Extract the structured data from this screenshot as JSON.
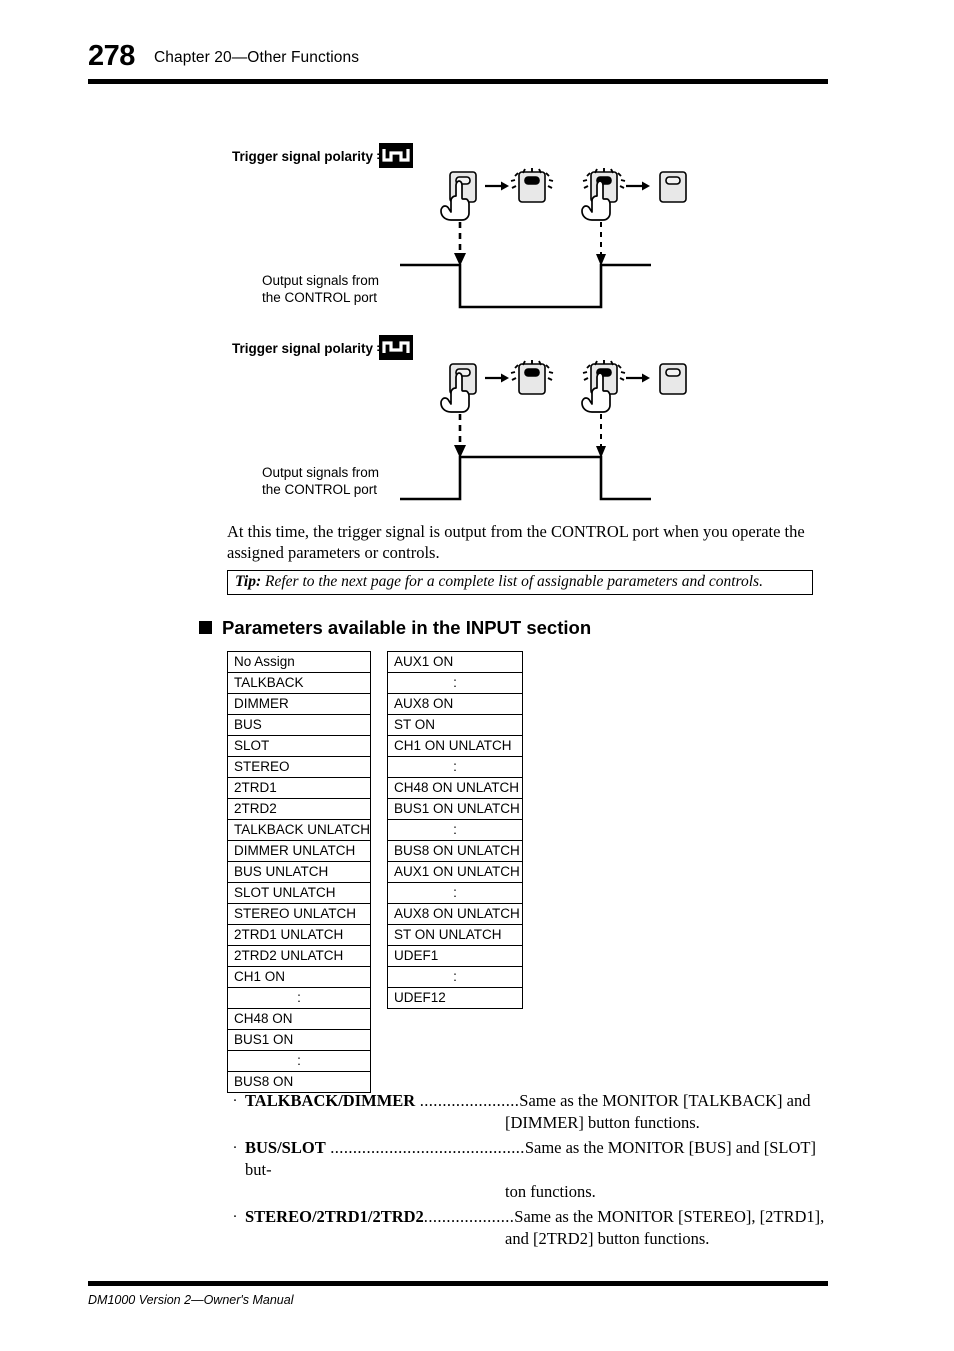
{
  "header": {
    "page_number": "278",
    "chapter_title": "Chapter 20—Other Functions"
  },
  "figures": [
    {
      "polarity_label": "Trigger signal polarity =",
      "polarity_icon": "falling-pulse-icon",
      "output_label_line1": "Output signals from",
      "output_label_line2": "the CONTROL port",
      "waveform": "low-pulse"
    },
    {
      "polarity_label": "Trigger signal polarity =",
      "polarity_icon": "rising-pulse-icon",
      "output_label_line1": "Output signals from",
      "output_label_line2": "the CONTROL port",
      "waveform": "high-pulse"
    }
  ],
  "body_paragraph": "At this time, the trigger signal is output from the CONTROL port when you operate the assigned parameters or controls.",
  "tip": {
    "label": "Tip:",
    "text": "Refer to the next page for a complete list of assignable parameters and controls."
  },
  "section_heading": "Parameters available in the INPUT section",
  "table_left": [
    "No Assign",
    "TALKBACK",
    "DIMMER",
    "BUS",
    "SLOT",
    "STEREO",
    "2TRD1",
    "2TRD2",
    "TALKBACK UNLATCH",
    "DIMMER UNLATCH",
    "BUS UNLATCH",
    "SLOT UNLATCH",
    "STEREO UNLATCH",
    "2TRD1 UNLATCH",
    "2TRD2 UNLATCH",
    "CH1 ON",
    ":",
    "CH48 ON",
    "BUS1 ON",
    ":",
    "BUS8 ON"
  ],
  "table_right": [
    "AUX1 ON",
    ":",
    "AUX8 ON",
    "ST ON",
    "CH1 ON UNLATCH",
    ":",
    "CH48 ON UNLATCH",
    "BUS1 ON UNLATCH",
    ":",
    "BUS8 ON UNLATCH",
    "AUX1 ON UNLATCH",
    ":",
    "AUX8 ON UNLATCH",
    "ST ON UNLATCH",
    "UDEF1",
    ":",
    "UDEF12"
  ],
  "bullets": [
    {
      "marker": "·",
      "term": "TALKBACK/DIMMER",
      "leader": " ......................",
      "desc_line1": "Same as the MONITOR [TALKBACK] and",
      "desc_line2": "[DIMMER] button functions."
    },
    {
      "marker": "·",
      "term": "BUS/SLOT",
      "leader": " ...........................................",
      "desc_line1": "Same as the MONITOR [BUS] and [SLOT] but-",
      "desc_line2": "ton functions."
    },
    {
      "marker": "·",
      "term": "STEREO/2TRD1/2TRD2",
      "leader": "....................",
      "desc_line1": "Same as the MONITOR [STEREO], [2TRD1],",
      "desc_line2": "and [2TRD2] button functions."
    }
  ],
  "footer": "DM1000 Version 2—Owner's Manual"
}
